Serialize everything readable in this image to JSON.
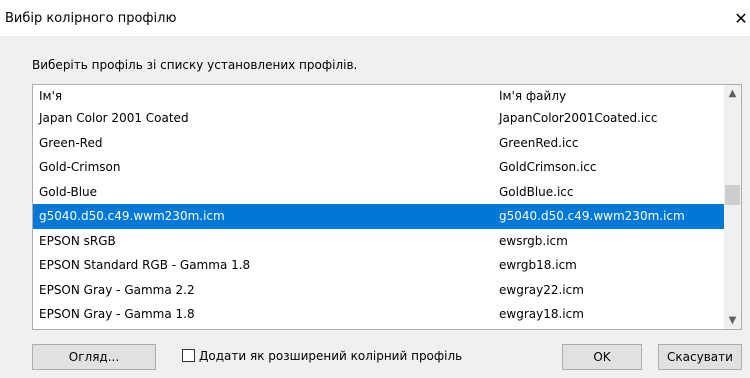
{
  "window": {
    "title": "Вибір колірного профілю",
    "close_glyph": "✕"
  },
  "prompt": "Виберіть профіль зі списку установлених профілів.",
  "list": {
    "columns": [
      "Ім'я",
      "Ім'я файлу"
    ],
    "rows": [
      {
        "name": "Japan Color 2001 Coated",
        "file": "JapanColor2001Coated.icc",
        "selected": false
      },
      {
        "name": "Green-Red",
        "file": "GreenRed.icc",
        "selected": false
      },
      {
        "name": "Gold-Crimson",
        "file": "GoldCrimson.icc",
        "selected": false
      },
      {
        "name": "Gold-Blue",
        "file": "GoldBlue.icc",
        "selected": false
      },
      {
        "name": "g5040.d50.c49.wwm230m.icm",
        "file": "g5040.d50.c49.wwm230m.icm",
        "selected": true
      },
      {
        "name": "EPSON  sRGB",
        "file": "ewsrgb.icm",
        "selected": false
      },
      {
        "name": "EPSON  Standard RGB - Gamma 1.8",
        "file": "ewrgb18.icm",
        "selected": false
      },
      {
        "name": "EPSON  Gray - Gamma 2.2",
        "file": "ewgray22.icm",
        "selected": false
      },
      {
        "name": "EPSON  Gray - Gamma 1.8",
        "file": "ewgray18.icm",
        "selected": false
      }
    ],
    "scroll_up_glyph": "▲",
    "scroll_down_glyph": "▼"
  },
  "buttons": {
    "browse": "Огляд...",
    "ok": "OK",
    "cancel": "Скасувати"
  },
  "checkbox": {
    "label": "Додати як розширений колірний профіль",
    "checked": false
  },
  "colors": {
    "selection": "#0078d7",
    "dialog_bg": "#f0f0f0"
  }
}
